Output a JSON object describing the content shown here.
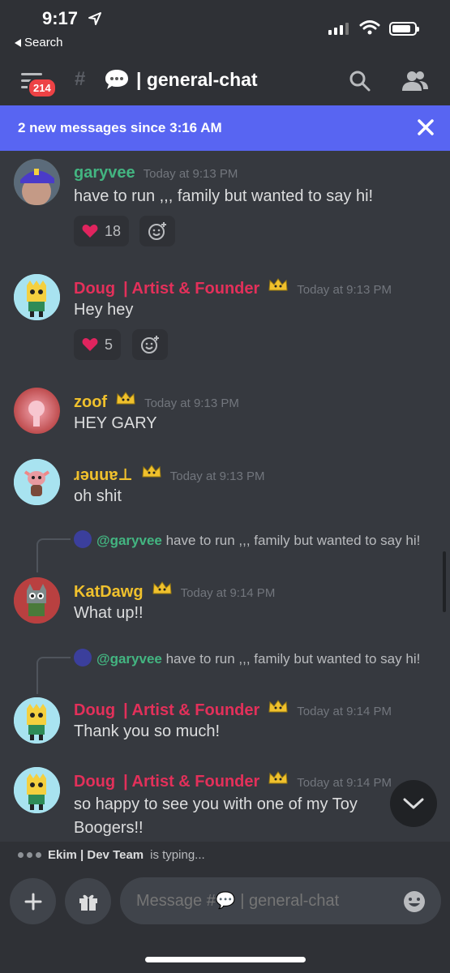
{
  "status_bar": {
    "time": "9:17",
    "back_label": "Search"
  },
  "header": {
    "unread_badge": "214",
    "channel_name": "| general-chat"
  },
  "banner": {
    "text": "2 new messages since 3:16 AM"
  },
  "messages": [
    {
      "author": "garyvee",
      "author_color": "#43b581",
      "timestamp": "Today at 9:13 PM",
      "text": "have to run ,,, family but wanted to say hi!",
      "reaction_emoji": "heart",
      "reaction_count": "18"
    },
    {
      "author": "Doug",
      "author_tag": "| Artist & Founder",
      "author_color": "#e3305a",
      "timestamp": "Today at 9:13 PM",
      "text": "Hey hey",
      "reaction_emoji": "heart",
      "reaction_count": "5"
    },
    {
      "author": "zoof",
      "author_color": "#f0c12d",
      "timestamp": "Today at 9:13 PM",
      "text": "HEY GARY"
    },
    {
      "author": "ɹǝuuɐ⊥",
      "author_color": "#f0c12d",
      "timestamp": "Today at 9:13 PM",
      "text": "oh shit"
    },
    {
      "reply_to": "@garyvee",
      "reply_text": "have to run ,,, family but wanted to say hi!",
      "author": "KatDawg",
      "author_color": "#f0c12d",
      "timestamp": "Today at 9:14 PM",
      "text": "What up!!"
    },
    {
      "reply_to": "@garyvee",
      "reply_text": "have to run ,,, family but wanted to say hi!",
      "author": "Doug",
      "author_tag": "| Artist & Founder",
      "author_color": "#e3305a",
      "timestamp": "Today at 9:14 PM",
      "text": "Thank you so much!"
    },
    {
      "author": "Doug",
      "author_tag": "| Artist & Founder",
      "author_color": "#e3305a",
      "timestamp": "Today at 9:14 PM",
      "text": "so happy to see you with one of my Toy Boogers!!"
    }
  ],
  "typing": {
    "user": "Ekim | Dev Team",
    "suffix": "is typing..."
  },
  "composer": {
    "placeholder": "Message #💬 | general-chat"
  },
  "colors": {
    "accent": "#5865f2",
    "background": "#36393f",
    "header": "#2f3136",
    "danger": "#ed4245"
  }
}
